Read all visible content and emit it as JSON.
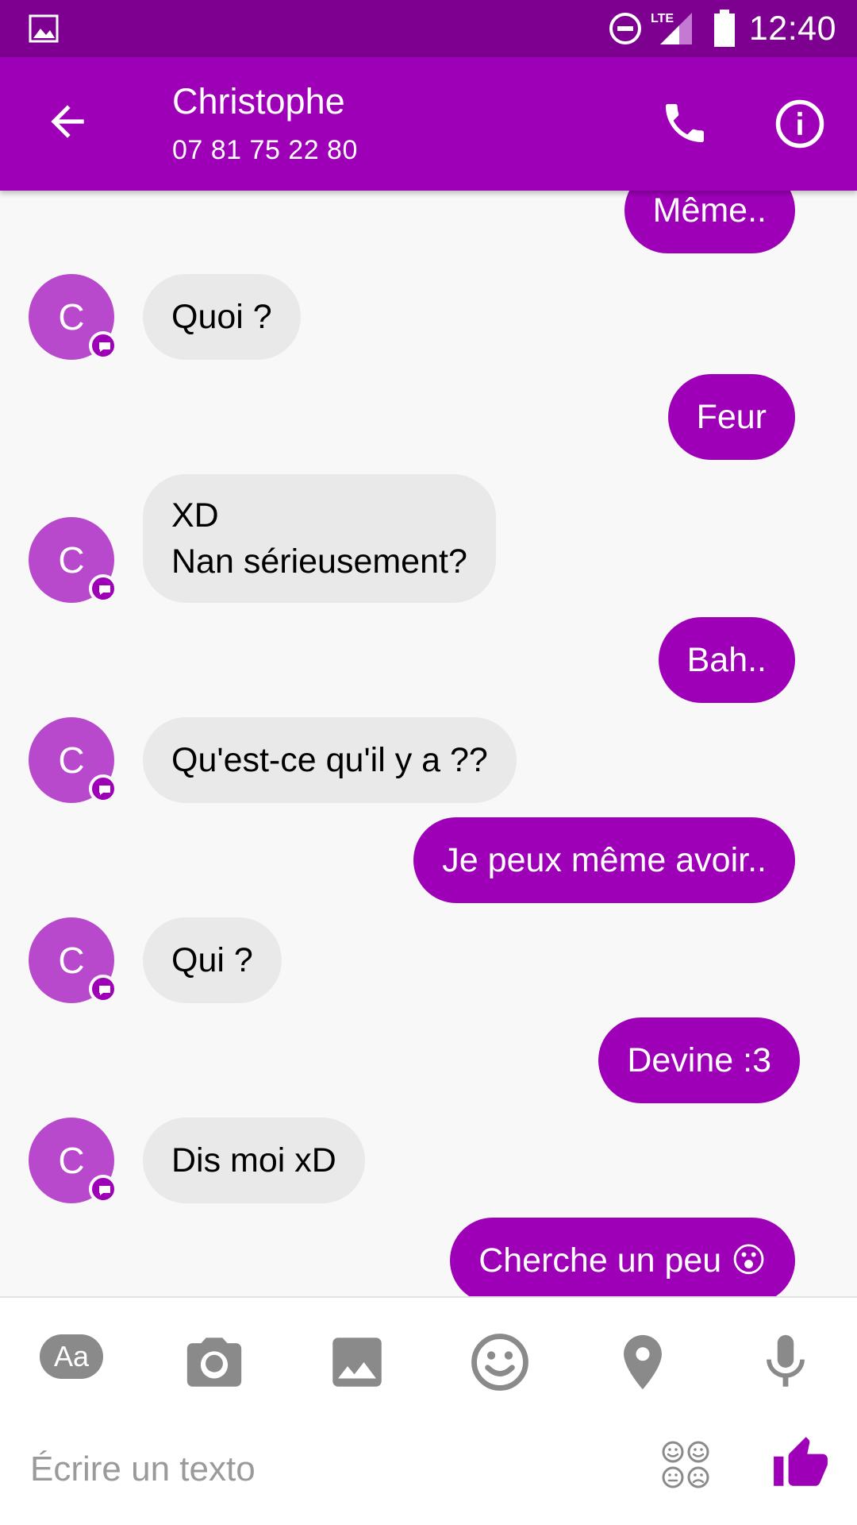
{
  "status_bar": {
    "time": "12:40",
    "network": "LTE"
  },
  "header": {
    "contact_name": "Christophe",
    "phone_number": "07 81 75 22 80"
  },
  "messages": [
    {
      "from": "me",
      "text": "Même.."
    },
    {
      "from": "them",
      "avatar_letter": "C",
      "text": "Quoi ?"
    },
    {
      "from": "me",
      "text": "Feur"
    },
    {
      "from": "them",
      "avatar_letter": "C",
      "line1": "XD",
      "line2": "Nan sérieusement?"
    },
    {
      "from": "me",
      "text": "Bah.."
    },
    {
      "from": "them",
      "avatar_letter": "C",
      "text": "Qu'est-ce qu'il y a ??"
    },
    {
      "from": "me",
      "text": "Je peux même avoir.."
    },
    {
      "from": "them",
      "avatar_letter": "C",
      "text": "Qui ?"
    },
    {
      "from": "me",
      "text": "Devine :3"
    },
    {
      "from": "them",
      "avatar_letter": "C",
      "text": "Dis moi xD"
    },
    {
      "from": "me",
      "text": "Cherche un peu",
      "emoji": "😮"
    }
  ],
  "composer": {
    "aa_label": "Aa",
    "placeholder": "Écrire un texto",
    "tools": [
      "text-format-icon",
      "camera-icon",
      "image-icon",
      "emoji-icon",
      "location-icon",
      "microphone-icon"
    ]
  },
  "colors": {
    "accent": "#9e00b8",
    "status_bar": "#7d0090",
    "incoming_bubble": "#e9e9e9",
    "avatar": "#b849cc"
  }
}
